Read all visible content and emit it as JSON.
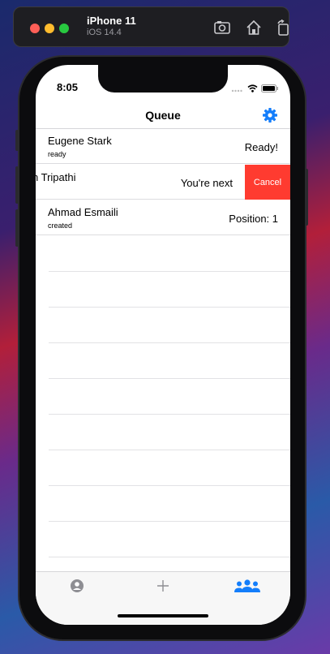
{
  "simulator": {
    "device_name": "iPhone 11",
    "os_version": "iOS 14.4"
  },
  "status_bar": {
    "time": "8:05"
  },
  "nav": {
    "title": "Queue"
  },
  "queue": {
    "rows": [
      {
        "name": "Eugene Stark",
        "status": "ready",
        "right_text": "Ready!"
      },
      {
        "name": "n Tripathi",
        "status": "",
        "right_text": "You're next",
        "action_label": "Cancel",
        "swiped": true
      },
      {
        "name": "Ahmad Esmaili",
        "status": "created",
        "right_text": "Position: 1"
      }
    ]
  },
  "tabs": [
    {
      "icon": "person-circle-icon",
      "active": false
    },
    {
      "icon": "plus-icon",
      "active": false
    },
    {
      "icon": "group-icon",
      "active": true
    }
  ],
  "colors": {
    "accent": "#147efb",
    "destructive": "#ff3b30",
    "inactive_tab": "#8e8e93"
  }
}
